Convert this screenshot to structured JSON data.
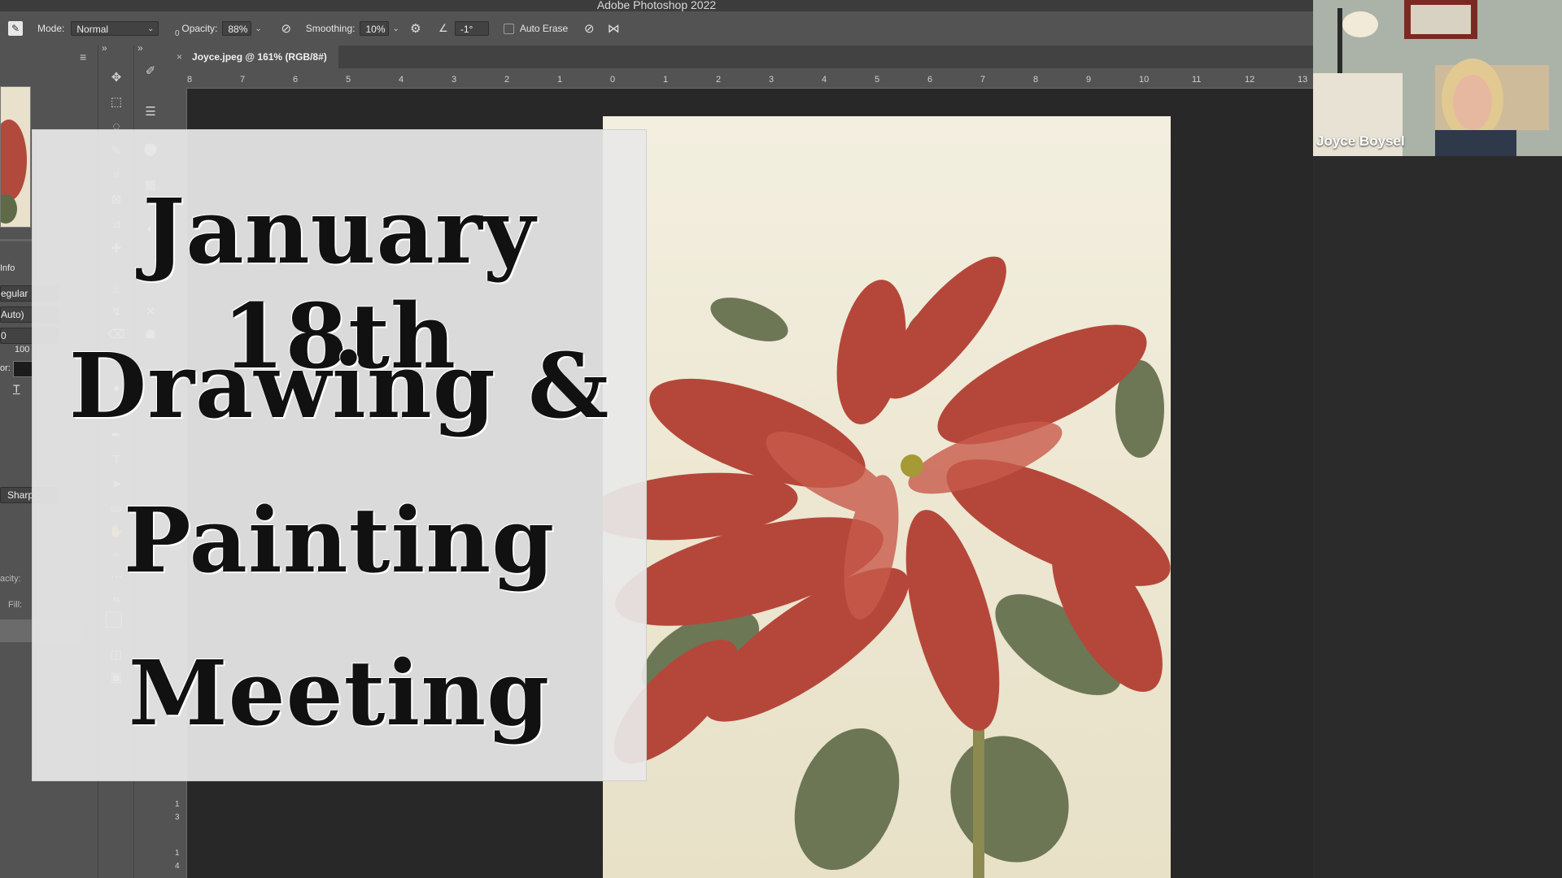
{
  "window": {
    "title": "Adobe Photoshop 2022"
  },
  "options_bar": {
    "mode_label": "Mode:",
    "mode_value": "Normal",
    "opacity_label": "Opacity:",
    "opacity_value": "88%",
    "smoothing_label": "Smoothing:",
    "smoothing_value": "10%",
    "angle_value": "-1°",
    "auto_erase_label": "Auto Erase"
  },
  "document_tab": {
    "close_glyph": "×",
    "title": "Joyce.jpeg @ 161% (RGB/8#)"
  },
  "ruler": {
    "horizontal": [
      "8",
      "7",
      "6",
      "5",
      "4",
      "3",
      "2",
      "1",
      "0",
      "1",
      "2",
      "3",
      "4",
      "5",
      "6",
      "7",
      "8",
      "9",
      "10",
      "11",
      "12",
      "13"
    ],
    "vertical": [
      "0",
      "1",
      "3",
      "1",
      "4"
    ]
  },
  "left_panel": {
    "info_label": "Info",
    "font_style": "egular",
    "auto": "Auto)",
    "zero": "0",
    "hundred": "100",
    "color_label": "or:",
    "antialias": "Sharp",
    "opacity_label": "acity:",
    "fill_label": "Fill:"
  },
  "overlay": {
    "line1": "January 18th",
    "line2": "Drawing &",
    "line3": "Painting",
    "line4": "Meeting"
  },
  "video": {
    "participant_name": "Joyce Boysel"
  },
  "colors": {
    "ui_dark": "#535353",
    "canvas_bg": "#282828",
    "poinsettia_red": "#b5473a",
    "leaf_green": "#5e6a48"
  }
}
